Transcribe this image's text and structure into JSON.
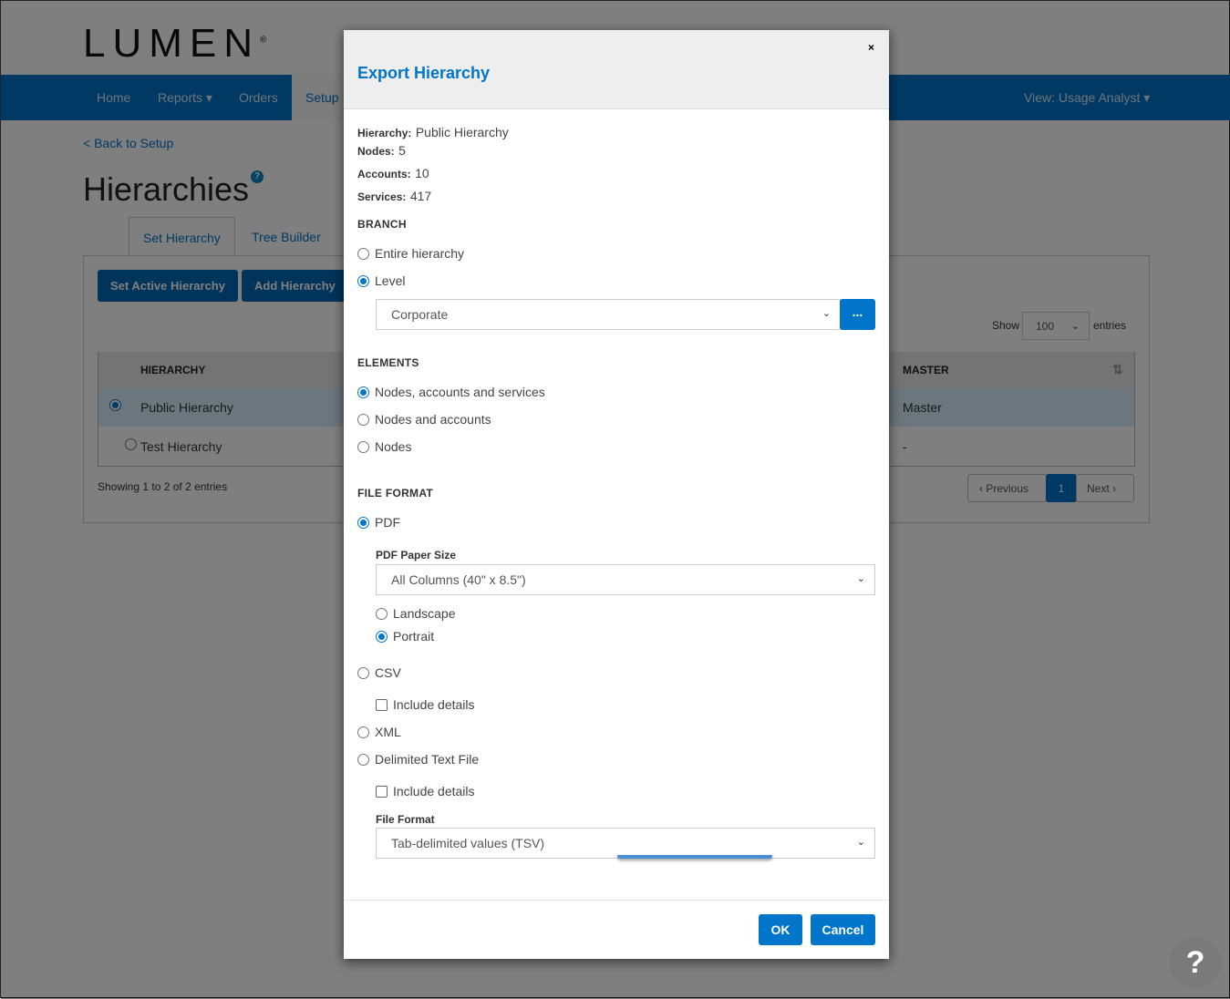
{
  "brand": {
    "logo": "LUMEN"
  },
  "nav": {
    "items": [
      "Home",
      "Reports",
      "Orders",
      "Setup"
    ],
    "active": "Setup",
    "view": "View: Usage Analyst"
  },
  "page": {
    "back_link": "< Back to Setup",
    "title": "Hierarchies",
    "help_badge": "?",
    "tabs": [
      "Set Hierarchy",
      "Tree Builder"
    ],
    "buttons": {
      "set_active": "Set Active Hierarchy",
      "add": "Add Hierarchy"
    },
    "show_label": "Show",
    "entries_value": "100",
    "entries_label": "entries",
    "table": {
      "headers": [
        "HIERARCHY",
        "MASTER"
      ],
      "rows": [
        {
          "name": "Public Hierarchy",
          "master": "Master",
          "selected": true
        },
        {
          "name": "Test Hierarchy",
          "master": "-",
          "selected": false
        }
      ]
    },
    "info": "Showing 1 to 2 of 2 entries",
    "pager": {
      "previous": "Previous",
      "current": "1",
      "next": "Next"
    }
  },
  "modal": {
    "title": "Export Hierarchy",
    "close": "×",
    "summary": [
      {
        "label": "Hierarchy:",
        "value": "Public Hierarchy"
      },
      {
        "label": "Nodes:",
        "value": "5"
      },
      {
        "label": "Accounts:",
        "value": "10"
      },
      {
        "label": "Services:",
        "value": "417"
      }
    ],
    "branch": {
      "heading": "BRANCH",
      "options": [
        "Entire hierarchy",
        "Level"
      ],
      "selected": "Level",
      "level_value": "Corporate",
      "browse_label": "..."
    },
    "elements": {
      "heading": "ELEMENTS",
      "options": [
        "Nodes, accounts and services",
        "Nodes and accounts",
        "Nodes"
      ],
      "selected": "Nodes, accounts and services"
    },
    "file_format": {
      "heading": "FILE FORMAT",
      "pdf": "PDF",
      "pdf_paper_label": "PDF Paper Size",
      "pdf_paper_value": "All Columns (40\" x 8.5\")",
      "orientation": [
        "Landscape",
        "Portrait"
      ],
      "orientation_selected": "Portrait",
      "csv": "CSV",
      "csv_include": "Include details",
      "xml": "XML",
      "delimited": "Delimited Text File",
      "delimited_include": "Include details",
      "format_label": "File Format",
      "format_value": "Tab-delimited values (TSV)",
      "selected": "PDF"
    },
    "ok": "OK",
    "cancel": "Cancel"
  },
  "help_button": "?",
  "colors": {
    "brand_blue": "#0075c9",
    "overlay": "rgba(0,0,0,0.5)"
  }
}
